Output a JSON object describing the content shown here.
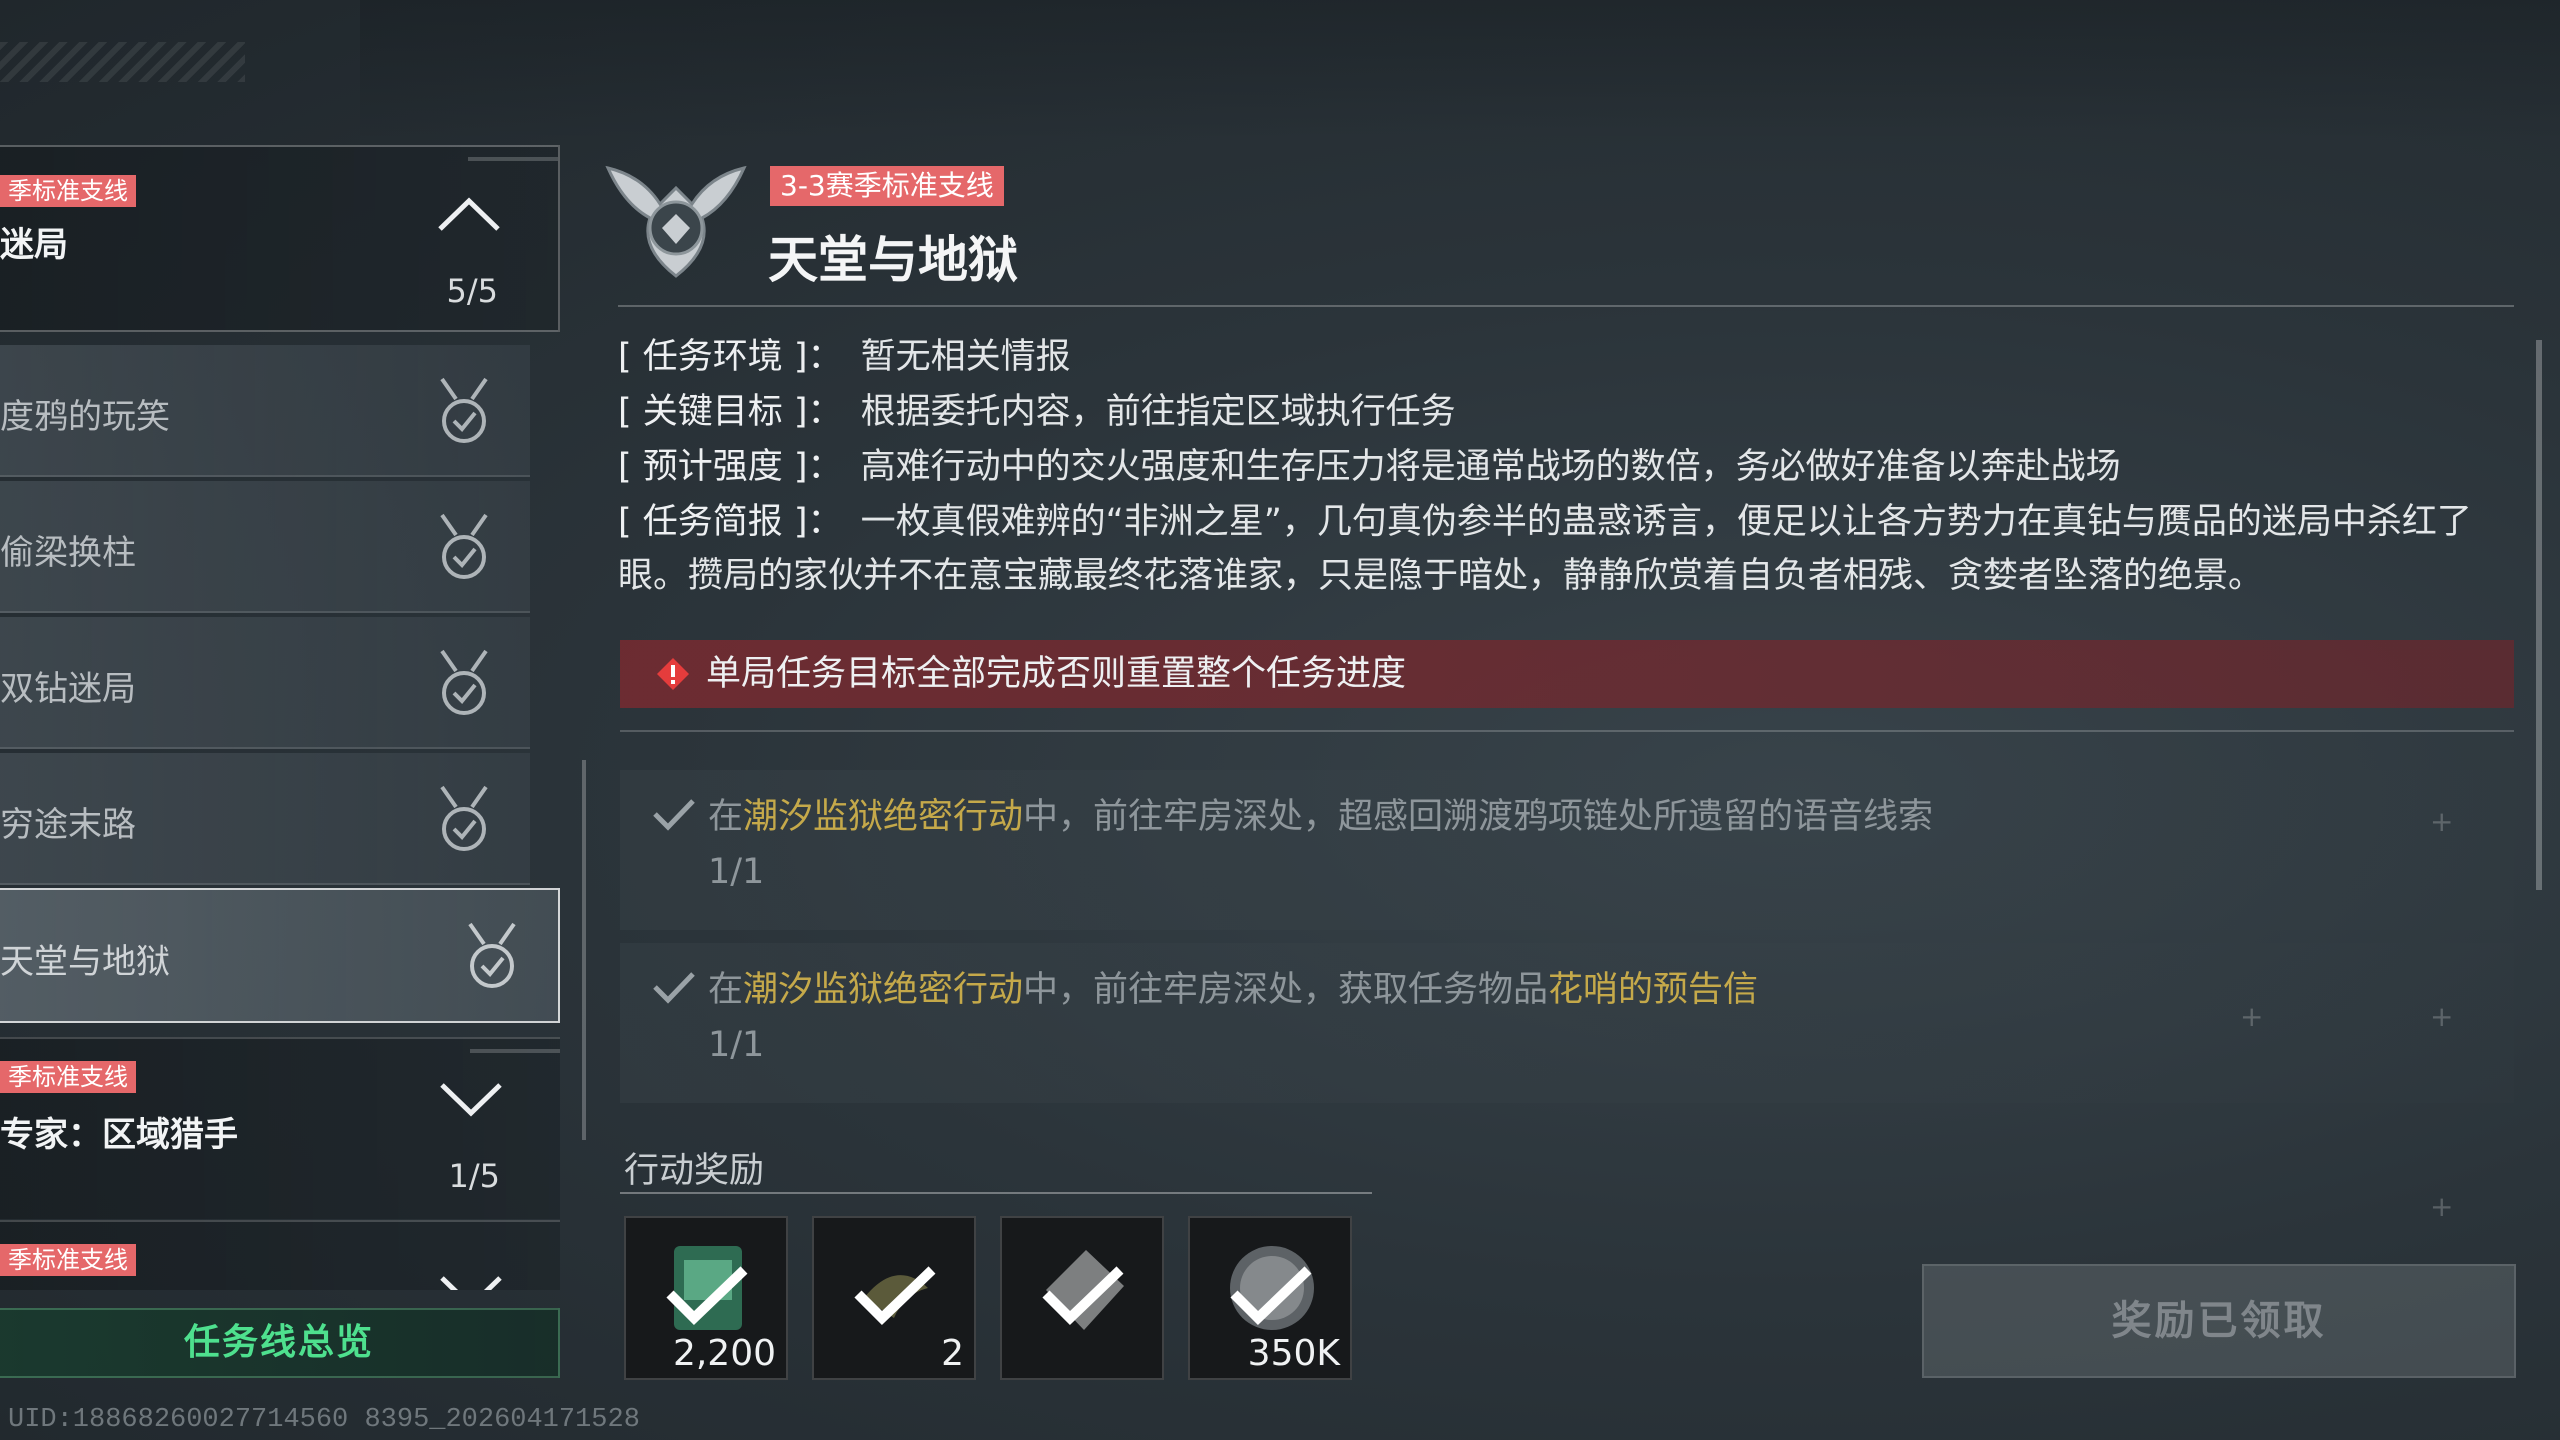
{
  "sidebar": {
    "lines": [
      {
        "tag": "季标准支线",
        "title": "迷局",
        "progress": "5/5",
        "expanded": true
      },
      {
        "tag": "季标准支线",
        "title": "专家：区域猎手",
        "progress": "1/5",
        "expanded": false
      },
      {
        "tag": "季标准支线",
        "title": "",
        "progress": "",
        "expanded": false
      }
    ],
    "items": [
      {
        "label": "度鸦的玩笑",
        "completed": true
      },
      {
        "label": "偷梁换柱",
        "completed": true
      },
      {
        "label": "双钻迷局",
        "completed": true
      },
      {
        "label": "穷途末路",
        "completed": true
      },
      {
        "label": "天堂与地狱",
        "completed": true,
        "selected": true
      }
    ],
    "overview_button": "任务线总览"
  },
  "uid": "UID:18868260027714560 8395_202604171528",
  "detail": {
    "tag": "3-3赛季标准支线",
    "title": "天堂与地狱",
    "info": [
      {
        "key": "[ 任务环境 ]：",
        "value": "暂无相关情报"
      },
      {
        "key": "[ 关键目标 ]：",
        "value": "根据委托内容，前往指定区域执行任务"
      },
      {
        "key": "[ 预计强度 ]：",
        "value": "高难行动中的交火强度和生存压力将是通常战场的数倍，务必做好准备以奔赴战场"
      },
      {
        "key": "[ 任务简报 ]：",
        "value": "一枚真假难辨的“非洲之星”，几句真伪参半的蛊惑诱言，便足以让各方势力在真钻与赝品的迷局中杀红了眼。攒局的家伙并不在意宝藏最终花落谁家，只是隐于暗处，静静欣赏着自负者相残、贪婪者坠落的绝景。"
      }
    ],
    "warning": "单局任务目标全部完成否则重置整个任务进度",
    "objectives": [
      {
        "prefix": "在",
        "highlight": "潮汐监狱绝密行动",
        "middle": "中，前往牢房深处，超感回溯渡鸦项链处所遗留的语音线索",
        "item": "",
        "count": "1/1"
      },
      {
        "prefix": "在",
        "highlight": "潮汐监狱绝密行动",
        "middle": "中，前往牢房深处，获取任务物品",
        "item": "花哨的预告信",
        "count": "1/1"
      }
    ],
    "rewards_label": "行动奖励",
    "rewards": [
      {
        "icon": "badge-icon",
        "qty": "2,200",
        "claimed": true
      },
      {
        "icon": "bird-item-icon",
        "qty": "2",
        "claimed": true
      },
      {
        "icon": "card-item-icon",
        "qty": "",
        "claimed": true
      },
      {
        "icon": "coin-icon",
        "qty": "350K",
        "claimed": true
      }
    ],
    "claim_button": "奖励已领取"
  },
  "colors": {
    "tag": "#e5686a",
    "highlight": "#c5a94a",
    "overview": "#4ee08e",
    "warning_bg": "#7a2a30"
  }
}
